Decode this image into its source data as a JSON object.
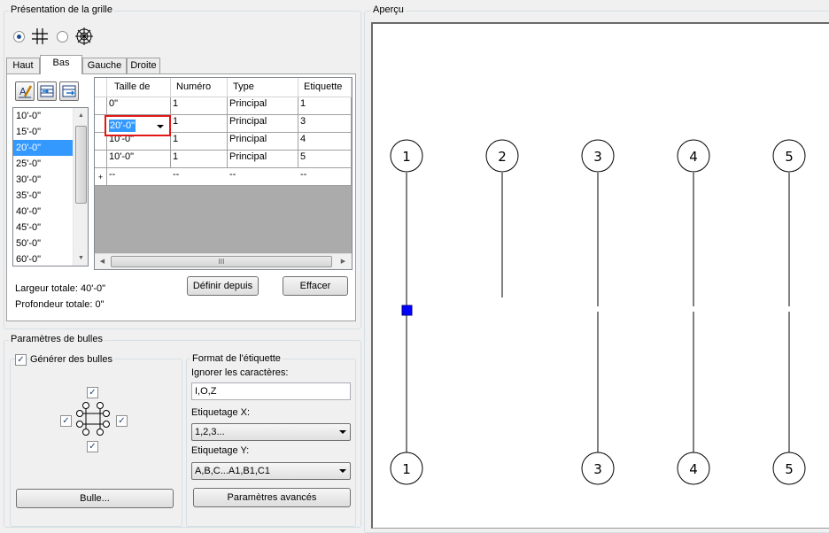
{
  "grid_presentation": {
    "title": "Présentation de la grille",
    "mode_icons": [
      {
        "icon": "rectangular-grid-icon",
        "selected": true
      },
      {
        "icon": "radial-grid-icon",
        "selected": false
      }
    ],
    "tabs": [
      "Haut",
      "Bas",
      "Gauche",
      "Droite"
    ],
    "active_tab": "Bas",
    "toolbar_icons": [
      "edit-label-icon",
      "insert-row-icon",
      "append-row-icon"
    ],
    "size_list": [
      "10'-0\"",
      "15'-0\"",
      "20'-0\"",
      "25'-0\"",
      "30'-0\"",
      "35'-0\"",
      "40'-0\"",
      "45'-0\"",
      "50'-0\"",
      "60'-0\""
    ],
    "selected_size": "20'-0\"",
    "table": {
      "columns": [
        "Taille de",
        "Numéro",
        "Type",
        "Etiquette"
      ],
      "rows": [
        [
          "0\"",
          "1",
          "Principal",
          "1"
        ],
        [
          "20'-0\"",
          "1",
          "Principal",
          "3"
        ],
        [
          "10'-0\"",
          "1",
          "Principal",
          "4"
        ],
        [
          "10'-0\"",
          "1",
          "Principal",
          "5"
        ]
      ],
      "new_row": [
        "--",
        "--",
        "--",
        "--"
      ],
      "new_row_marker": "+",
      "editing_cell": "20'-0\""
    },
    "hscroll_grip": "III",
    "total_width": "Largeur totale: 40'-0\"",
    "total_depth": "Profondeur totale: 0\"",
    "define_from_button": "Définir depuis",
    "clear_button": "Effacer"
  },
  "bubble_params": {
    "title": "Paramètres de bulles",
    "generate_label": "Générer des bulles",
    "generate_checked": true,
    "bubble_positions": {
      "top": true,
      "left": true,
      "right": true,
      "bottom": true
    },
    "bubble_button": "Bulle...",
    "label_format": {
      "title": "Format de l'étiquette",
      "ignore_label": "Ignorer les caractères:",
      "ignore_value": "I,O,Z",
      "x_label": "Etiquetage X:",
      "x_value": "1,2,3...",
      "y_label": "Etiquetage Y:",
      "y_value": "A,B,C...A1,B1,C1",
      "advanced_button": "Paramètres avancés"
    }
  },
  "preview": {
    "title": "Aperçu",
    "top_bubbles": [
      "1",
      "2",
      "3",
      "4",
      "5"
    ],
    "bottom_bubbles": [
      "1",
      "3",
      "4",
      "5"
    ],
    "selection_color": "#0000ff"
  }
}
